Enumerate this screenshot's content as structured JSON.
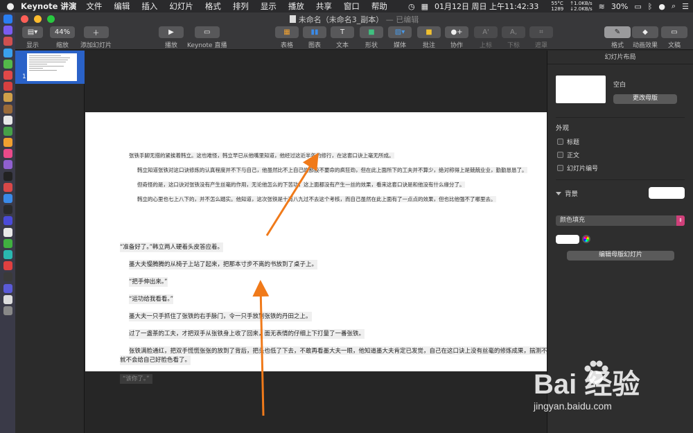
{
  "menubar": {
    "app": "Keynote 讲演",
    "items": [
      "文件",
      "编辑",
      "插入",
      "幻灯片",
      "格式",
      "排列",
      "显示",
      "播放",
      "共享",
      "窗口",
      "帮助"
    ],
    "date": "01月12日 周日 上午11:42:33",
    "temp": "55°C",
    "fan": "1289",
    "net_up": "↑1.0KB/s",
    "net_down": "↓2.0KB/s",
    "battery": "30%"
  },
  "window": {
    "title": "未命名（未命名3_副本）",
    "edited": "— 已编辑",
    "zoom": "44%"
  },
  "toolbar": {
    "view": "显示",
    "zoom": "缩放",
    "add_slide": "添加幻灯片",
    "play": "播放",
    "keynote_live": "Keynote 直播",
    "table": "表格",
    "chart": "图表",
    "text": "文本",
    "shape": "形状",
    "media": "媒体",
    "comment": "批注",
    "collaborate": "协作",
    "superscript": "上标",
    "subscript": "下标",
    "mask": "遮罩",
    "format": "格式",
    "animate": "动画效果",
    "document": "文稿"
  },
  "navigator": {
    "slide_number": "1"
  },
  "slide": {
    "paragraphs": [
      "张铁手脚无措的紧挨着韩立。这也难怪，韩立早已从他嘴里知道，他经过这近半年的修行，在这套口诀上毫无所成。",
      "韩立知道张铁对这口诀修炼的认真程度并不下与自己，他虽然比不上自己的那股不要命的疯狂劲，但在此上面所下的工夫并不算少，绝对称得上是兢兢业业，勤勤恳恳了。",
      "但奇怪的是，这口诀对张铁没有产生丝毫的作用，无论他怎么的下苦功，这上面都没有产生一丝的效果，看来这套口诀是和他没有什么缘分了。",
      "韩立的心里也七上八下的，并不怎么踏实。他知道，这次张铁是十有八九过不去这个考核，而自己虽然在此上面有了一点点的效果，但也比他强不了哪里去。"
    ],
    "body": [
      "“准备好了。”韩立两人硬着头皮答应着。",
      "墨大夫慢腾腾的从椅子上站了起来，把那本寸步不离的书放到了桌子上。",
      "“把手伸出来。”",
      "“运功给我看看。”",
      "墨大夫一只手抓住了张铁的右手脉门，令一只手放到张铁的丹田之上。",
      "过了一盏茶的工夫，才把双手从张铁身上收了回来，面无表情的仔细上下打量了一番张铁。",
      "张铁满脸通红，把双手慌慌张张的放到了背后，把头也低了下去，不敢再看墨大夫一眼，他知道墨大夫肯定已发觉，自己在这口诀上没有丝毫的修炼成果，揣测不会给自己好脸色看了。"
    ],
    "body_wrap": "就不会给自己好脸色看了。",
    "overflow": "“该你了。”"
  },
  "inspector": {
    "header": "幻灯片布局",
    "layout_name": "空白",
    "change_master": "更改母版",
    "appearance": "外观",
    "opt_title": "标题",
    "opt_body": "正文",
    "opt_slide_number": "幻灯片编号",
    "background": "背景",
    "fill_type": "颜色填充",
    "edit_master": "编辑母版幻灯片"
  },
  "watermark": {
    "brand": "Bai 经验",
    "url": "jingyan.baidu.com"
  },
  "colors": {
    "accent": "#2a62c8",
    "arrow": "#f07a1a",
    "select_arrow": "#d0407a"
  }
}
